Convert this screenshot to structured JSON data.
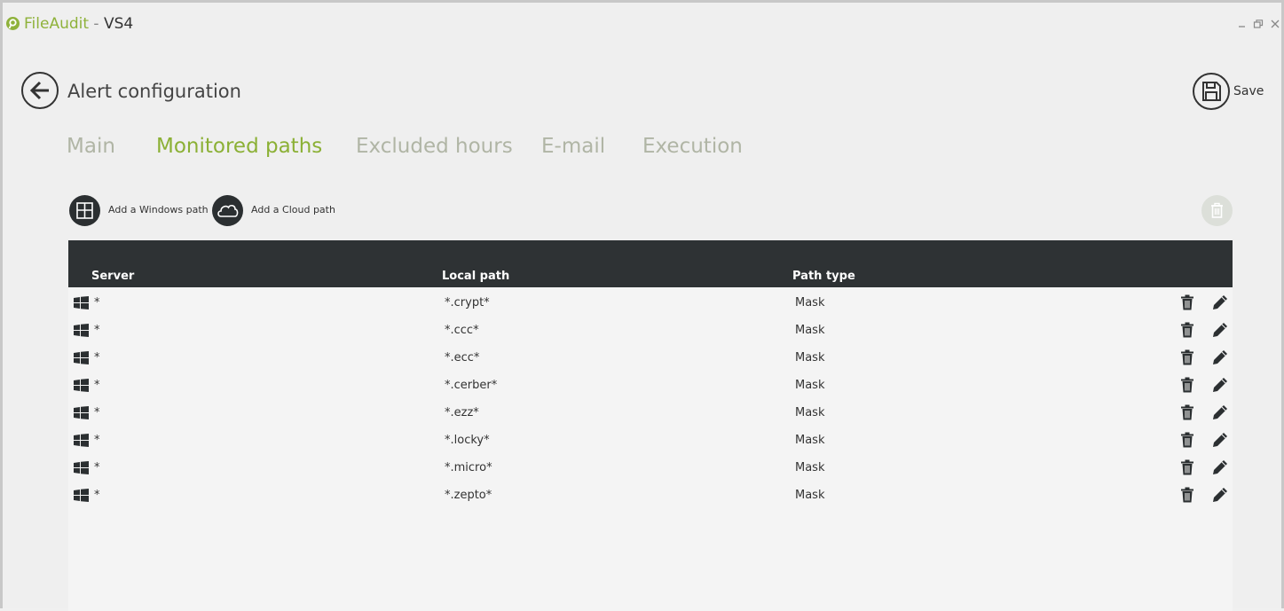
{
  "window": {
    "app_name": "FileAudit",
    "separator": " - ",
    "host": "VS4",
    "controls": [
      "minimize-icon",
      "restore-icon",
      "close-icon"
    ]
  },
  "header": {
    "title": "Alert configuration",
    "save_label": "Save"
  },
  "tabs": [
    {
      "label": "Main",
      "active": false
    },
    {
      "label": "Monitored paths",
      "active": true
    },
    {
      "label": "Excluded hours",
      "active": false
    },
    {
      "label": "E-mail",
      "active": false
    },
    {
      "label": "Execution",
      "active": false
    }
  ],
  "toolbar": {
    "add_windows_label": "Add a Windows path",
    "add_cloud_label": "Add a Cloud path"
  },
  "table": {
    "columns": [
      "Server",
      "Local path",
      "Path type"
    ],
    "rows": [
      {
        "server": "*",
        "local_path": "*.crypt*",
        "path_type": "Mask"
      },
      {
        "server": "*",
        "local_path": "*.ccc*",
        "path_type": "Mask"
      },
      {
        "server": "*",
        "local_path": "*.ecc*",
        "path_type": "Mask"
      },
      {
        "server": "*",
        "local_path": "*.cerber*",
        "path_type": "Mask"
      },
      {
        "server": "*",
        "local_path": "*.ezz*",
        "path_type": "Mask"
      },
      {
        "server": "*",
        "local_path": "*.locky*",
        "path_type": "Mask"
      },
      {
        "server": "*",
        "local_path": "*.micro*",
        "path_type": "Mask"
      },
      {
        "server": "*",
        "local_path": "*.zepto*",
        "path_type": "Mask"
      }
    ]
  },
  "colors": {
    "accent": "#8bb035",
    "tab_inactive": "#b0b5a5",
    "header_dark": "#2e3234"
  }
}
